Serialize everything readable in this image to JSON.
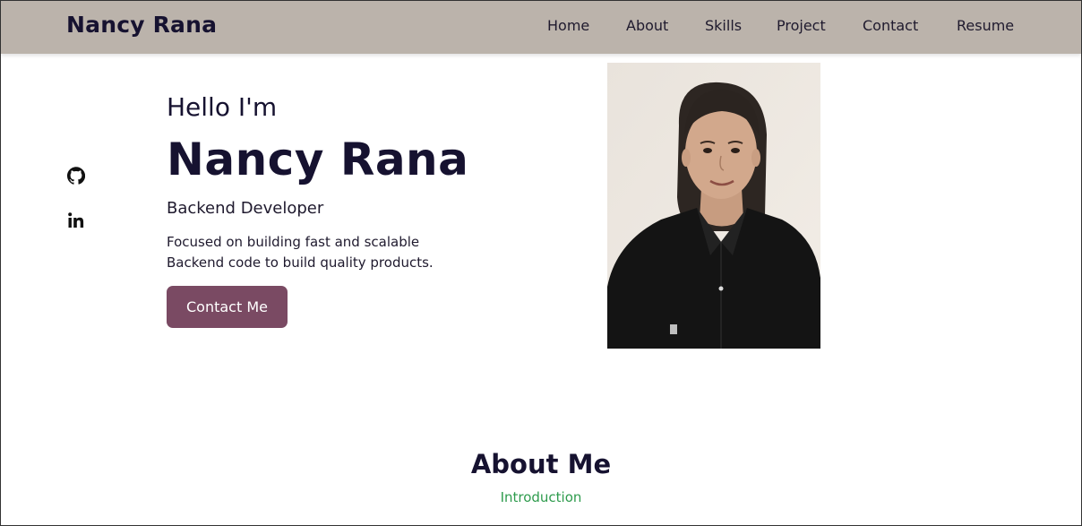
{
  "nav": {
    "brand": "Nancy Rana",
    "links": [
      "Home",
      "About",
      "Skills",
      "Project",
      "Contact",
      "Resume"
    ]
  },
  "socials": [
    {
      "name": "github-icon"
    },
    {
      "name": "linkedin-icon"
    }
  ],
  "hero": {
    "greeting": "Hello I'm",
    "name": "Nancy Rana",
    "role": "Backend Developer",
    "tagline_line1": "Focused on building fast and scalable",
    "tagline_line2": "Backend code to build quality products.",
    "cta_label": "Contact Me"
  },
  "about": {
    "title": "About Me",
    "subtitle": "Introduction"
  },
  "colors": {
    "navbar_bg": "#bbb3ab",
    "text_dark": "#161230",
    "button_bg": "#7a4a63",
    "accent_green": "#2e9b4d"
  }
}
